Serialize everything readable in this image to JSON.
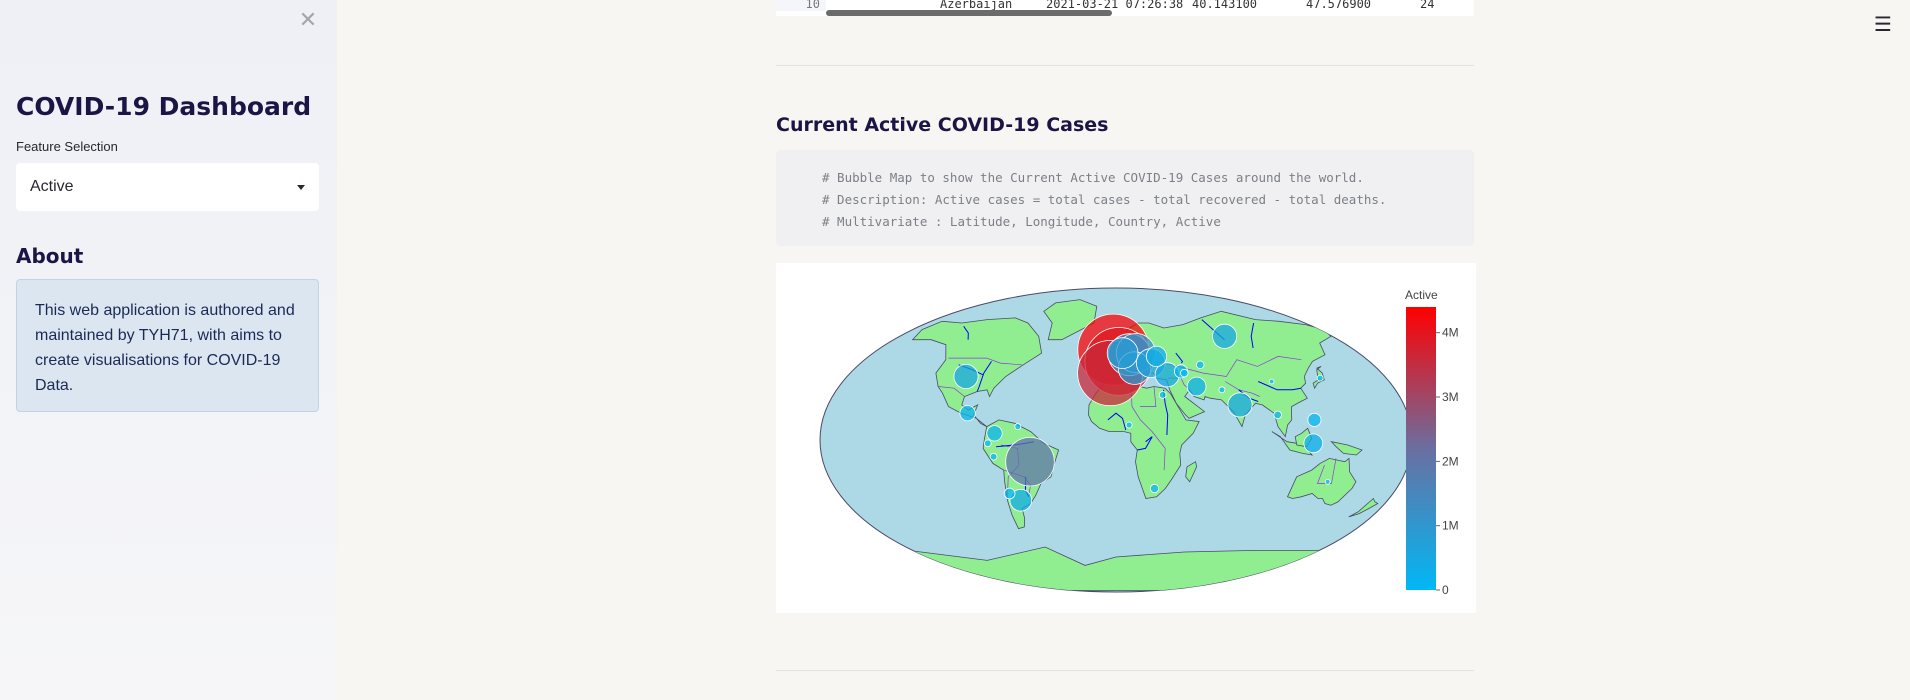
{
  "sidebar": {
    "title": "COVID-19 Dashboard",
    "feature_label": "Feature Selection",
    "feature_value": "Active",
    "about_title": "About",
    "about_text": "This web application is authored and maintained by TYH71, with aims to create visualisations for COVID-19 Data."
  },
  "dataframe": {
    "index": "10",
    "country": "Azerbaijan",
    "last_update": "2021-03-21 07:26:38",
    "lat": "40.143100",
    "long": "47.576900",
    "partial": "24"
  },
  "section": {
    "title": "Current Active COVID-19 Cases",
    "code_lines": [
      "# Bubble Map to show the Current Active COVID-19 Cases around the world.",
      "# Description: Active cases = total cases - total recovered - total deaths.",
      "# Multivariate : Latitude, Longitude, Country, Active"
    ]
  },
  "chart_data": {
    "type": "scatter",
    "projection": "robinson",
    "colorbar": {
      "title": "Active",
      "tick_labels": [
        "4M",
        "3M",
        "2M",
        "1M",
        "0"
      ],
      "tick_values": [
        4000000,
        3000000,
        2000000,
        1000000,
        0
      ],
      "range": [
        0,
        4400000
      ],
      "color_low": "#00b8f5",
      "color_high": "#ff0000"
    },
    "colors": {
      "ocean": "#add8e6",
      "land": "#90ee90",
      "coastline": "#4a4a68",
      "rivers": "#0000ff",
      "borders": "#8a3ad8"
    },
    "bubbles": [
      {
        "lon": -2,
        "lat": 54,
        "active": 4300000
      },
      {
        "lon": 2,
        "lat": 47,
        "active": 3900000
      },
      {
        "lon": -4,
        "lat": 40,
        "active": 3600000
      },
      {
        "lon": 10,
        "lat": 51,
        "active": 1500000
      },
      {
        "lon": 15,
        "lat": 52,
        "active": 1300000
      },
      {
        "lon": 13,
        "lat": 43,
        "active": 900000
      },
      {
        "lon": 5,
        "lat": 52,
        "active": 800000
      },
      {
        "lon": 25,
        "lat": 46,
        "active": 700000
      },
      {
        "lon": 35,
        "lat": 39,
        "active": 500000
      },
      {
        "lon": 90,
        "lat": 62,
        "active": 500000
      },
      {
        "lon": 78,
        "lat": 21,
        "active": 500000
      },
      {
        "lon": -102,
        "lat": 38,
        "active": 500000
      },
      {
        "lon": -53,
        "lat": -13,
        "active": 2000000
      },
      {
        "lon": -64,
        "lat": -36,
        "active": 400000
      },
      {
        "lon": -74,
        "lat": 4,
        "active": 200000
      },
      {
        "lon": -92,
        "lat": 16,
        "active": 200000
      },
      {
        "lon": 53,
        "lat": 32,
        "active": 300000
      },
      {
        "lon": 45,
        "lat": 41,
        "active": 150000
      },
      {
        "lon": 120,
        "lat": -2,
        "active": 300000
      },
      {
        "lon": 122,
        "lat": 12,
        "active": 150000
      },
      {
        "lon": 30,
        "lat": 50,
        "active": 350000
      },
      {
        "lon": -70,
        "lat": -32,
        "active": 100000
      },
      {
        "lon": 100,
        "lat": 15,
        "active": 50000
      },
      {
        "lon": 60,
        "lat": 45,
        "active": 50000
      },
      {
        "lon": 47,
        "lat": 40,
        "active": 50000
      },
      {
        "lon": 25,
        "lat": -29,
        "active": 60000
      },
      {
        "lon": 30,
        "lat": 27,
        "active": 40000
      },
      {
        "lon": 8,
        "lat": 9,
        "active": 30000
      },
      {
        "lon": -60,
        "lat": 8,
        "active": 30000
      },
      {
        "lon": -78,
        "lat": -2,
        "active": 40000
      },
      {
        "lon": -75,
        "lat": -10,
        "active": 40000
      },
      {
        "lon": 135,
        "lat": -25,
        "active": 20000
      },
      {
        "lon": 104,
        "lat": 35,
        "active": 20000
      },
      {
        "lon": 138,
        "lat": 37,
        "active": 30000
      },
      {
        "lon": 69,
        "lat": 30,
        "active": 30000
      }
    ]
  }
}
